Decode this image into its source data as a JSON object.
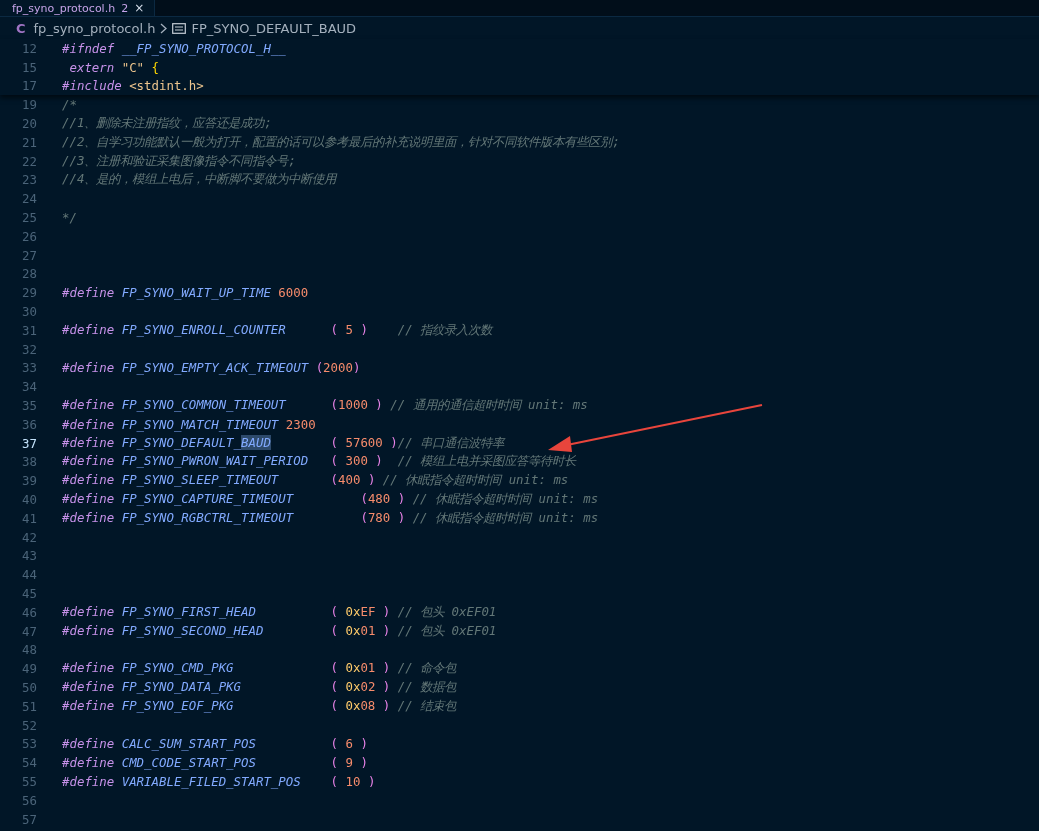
{
  "tab": {
    "label": "fp_syno_protocol.h",
    "badge": "2",
    "close": "×"
  },
  "breadcrumb": {
    "file_icon": "C",
    "file": "fp_syno_protocol.h",
    "symbol": "FP_SYNO_DEFAULT_BAUD"
  },
  "sticky_lines": [
    {
      "number": "12",
      "current": false,
      "tokens": [
        {
          "kind": "directive",
          "text": "#ifndef"
        },
        {
          "kind": "macro",
          "text": " __FP_SYNO_PROTOCOL_H__"
        }
      ]
    },
    {
      "number": "15",
      "current": false,
      "tokens": [
        {
          "kind": "keyword",
          "text": " extern"
        },
        {
          "kind": "string",
          "text": " \"C\""
        },
        {
          "kind": "brace",
          "text": " {"
        }
      ]
    },
    {
      "number": "17",
      "current": false,
      "tokens": [
        {
          "kind": "directive",
          "text": "#include"
        },
        {
          "kind": "header",
          "text": " <stdint.h>"
        }
      ]
    }
  ],
  "lines": [
    {
      "number": "19",
      "current": false,
      "tokens": [
        {
          "kind": "comment",
          "text": "/*"
        }
      ]
    },
    {
      "number": "20",
      "current": false,
      "tokens": [
        {
          "kind": "comment",
          "text": "//1、删除未注册指纹，应答还是成功;"
        }
      ]
    },
    {
      "number": "21",
      "current": false,
      "tokens": [
        {
          "kind": "comment",
          "text": "//2、自学习功能默认一般为打开，配置的话可以参考最后的补充说明里面，针对不同软件版本有些区别;"
        }
      ]
    },
    {
      "number": "22",
      "current": false,
      "tokens": [
        {
          "kind": "comment",
          "text": "//3、注册和验证采集图像指令不同指令号;"
        }
      ]
    },
    {
      "number": "23",
      "current": false,
      "tokens": [
        {
          "kind": "comment",
          "text": "//4、是的，模组上电后，中断脚不要做为中断使用"
        }
      ]
    },
    {
      "number": "24",
      "current": false
    },
    {
      "number": "25",
      "current": false,
      "tokens": [
        {
          "kind": "comment",
          "text": "*/"
        }
      ]
    },
    {
      "number": "26",
      "current": false
    },
    {
      "number": "27",
      "current": false
    },
    {
      "number": "28",
      "current": false
    },
    {
      "number": "29",
      "current": false,
      "tokens": [
        {
          "kind": "directive",
          "text": "#define"
        },
        {
          "kind": "macro",
          "text": " FP_SYNO_WAIT_UP_TIME"
        },
        {
          "kind": "number",
          "text": " 6000"
        }
      ]
    },
    {
      "number": "30",
      "current": false
    },
    {
      "number": "31",
      "current": false,
      "tokens": [
        {
          "kind": "directive",
          "text": "#define"
        },
        {
          "kind": "macro",
          "text": " FP_SYNO_ENROLL_COUNTER"
        },
        {
          "kind": "paren",
          "text": "      ("
        },
        {
          "kind": "number",
          "text": " 5"
        },
        {
          "kind": "paren",
          "text": " )"
        },
        {
          "kind": "comment",
          "text": "    // 指纹录入次数"
        }
      ]
    },
    {
      "number": "32",
      "current": false
    },
    {
      "number": "33",
      "current": false,
      "tokens": [
        {
          "kind": "directive",
          "text": "#define"
        },
        {
          "kind": "macro",
          "text": " FP_SYNO_EMPTY_ACK_TIMEOUT"
        },
        {
          "kind": "paren",
          "text": " ("
        },
        {
          "kind": "number",
          "text": "2000"
        },
        {
          "kind": "paren",
          "text": ")"
        }
      ]
    },
    {
      "number": "34",
      "current": false
    },
    {
      "number": "35",
      "current": false,
      "tokens": [
        {
          "kind": "directive",
          "text": "#define"
        },
        {
          "kind": "macro",
          "text": " FP_SYNO_COMMON_TIMEOUT"
        },
        {
          "kind": "paren",
          "text": "      ("
        },
        {
          "kind": "number",
          "text": "1000"
        },
        {
          "kind": "paren",
          "text": " )"
        },
        {
          "kind": "comment",
          "text": " // 通用的通信超时时间 unit: ms"
        }
      ]
    },
    {
      "number": "36",
      "current": false,
      "tokens": [
        {
          "kind": "directive",
          "text": "#define"
        },
        {
          "kind": "macro",
          "text": " FP_SYNO_MATCH_TIMEOUT"
        },
        {
          "kind": "number",
          "text": " 2300"
        }
      ]
    },
    {
      "number": "37",
      "current": true,
      "tokens": [
        {
          "kind": "directive",
          "text": "#define"
        },
        {
          "kind": "macro",
          "text": " FP_SYNO_DEFAULT_"
        },
        {
          "kind": "macro",
          "text": "BAUD",
          "highlighted": true
        },
        {
          "kind": "paren",
          "text": "        ("
        },
        {
          "kind": "number",
          "text": " 57600"
        },
        {
          "kind": "paren",
          "text": " )"
        },
        {
          "kind": "comment",
          "text": "// 串口通信波特率"
        }
      ]
    },
    {
      "number": "38",
      "current": false,
      "tokens": [
        {
          "kind": "directive",
          "text": "#define"
        },
        {
          "kind": "macro",
          "text": " FP_SYNO_PWRON_WAIT_PERIOD"
        },
        {
          "kind": "paren",
          "text": "   ("
        },
        {
          "kind": "number",
          "text": " 300"
        },
        {
          "kind": "paren",
          "text": " )"
        },
        {
          "kind": "comment",
          "text": "  // 模组上电并采图应答等待时长"
        }
      ]
    },
    {
      "number": "39",
      "current": false,
      "tokens": [
        {
          "kind": "directive",
          "text": "#define"
        },
        {
          "kind": "macro",
          "text": " FP_SYNO_SLEEP_TIMEOUT"
        },
        {
          "kind": "paren",
          "text": "       ("
        },
        {
          "kind": "number",
          "text": "400"
        },
        {
          "kind": "paren",
          "text": " )"
        },
        {
          "kind": "comment",
          "text": " // 休眠指令超时时间 unit: ms"
        }
      ]
    },
    {
      "number": "40",
      "current": false,
      "tokens": [
        {
          "kind": "directive",
          "text": "#define"
        },
        {
          "kind": "macro",
          "text": " FP_SYNO_CAPTURE_TIMEOUT"
        },
        {
          "kind": "paren",
          "text": "         ("
        },
        {
          "kind": "number",
          "text": "480"
        },
        {
          "kind": "paren",
          "text": " )"
        },
        {
          "kind": "comment",
          "text": " // 休眠指令超时时间 unit: ms"
        }
      ]
    },
    {
      "number": "41",
      "current": false,
      "tokens": [
        {
          "kind": "directive",
          "text": "#define"
        },
        {
          "kind": "macro",
          "text": " FP_SYNO_RGBCTRL_TIMEOUT"
        },
        {
          "kind": "paren",
          "text": "         ("
        },
        {
          "kind": "number",
          "text": "780"
        },
        {
          "kind": "paren",
          "text": " )"
        },
        {
          "kind": "comment",
          "text": " // 休眠指令超时时间 unit: ms"
        }
      ]
    },
    {
      "number": "42",
      "current": false
    },
    {
      "number": "43",
      "current": false
    },
    {
      "number": "44",
      "current": false
    },
    {
      "number": "45",
      "current": false
    },
    {
      "number": "46",
      "current": false,
      "tokens": [
        {
          "kind": "directive",
          "text": "#define"
        },
        {
          "kind": "macro",
          "text": " FP_SYNO_FIRST_HEAD"
        },
        {
          "kind": "paren",
          "text": "          ("
        },
        {
          "kind": "hexprefix",
          "text": " 0x"
        },
        {
          "kind": "number",
          "text": "EF"
        },
        {
          "kind": "paren",
          "text": " )"
        },
        {
          "kind": "comment",
          "text": " // 包头 0xEF01"
        }
      ]
    },
    {
      "number": "47",
      "current": false,
      "tokens": [
        {
          "kind": "directive",
          "text": "#define"
        },
        {
          "kind": "macro",
          "text": " FP_SYNO_SECOND_HEAD"
        },
        {
          "kind": "paren",
          "text": "         ("
        },
        {
          "kind": "hexprefix",
          "text": " 0x"
        },
        {
          "kind": "number",
          "text": "01"
        },
        {
          "kind": "paren",
          "text": " )"
        },
        {
          "kind": "comment",
          "text": " // 包头 0xEF01"
        }
      ]
    },
    {
      "number": "48",
      "current": false
    },
    {
      "number": "49",
      "current": false,
      "tokens": [
        {
          "kind": "directive",
          "text": "#define"
        },
        {
          "kind": "macro",
          "text": " FP_SYNO_CMD_PKG"
        },
        {
          "kind": "paren",
          "text": "             ("
        },
        {
          "kind": "hexprefix",
          "text": " 0x"
        },
        {
          "kind": "number",
          "text": "01"
        },
        {
          "kind": "paren",
          "text": " )"
        },
        {
          "kind": "comment",
          "text": " // 命令包"
        }
      ]
    },
    {
      "number": "50",
      "current": false,
      "tokens": [
        {
          "kind": "directive",
          "text": "#define"
        },
        {
          "kind": "macro",
          "text": " FP_SYNO_DATA_PKG"
        },
        {
          "kind": "paren",
          "text": "            ("
        },
        {
          "kind": "hexprefix",
          "text": " 0x"
        },
        {
          "kind": "number",
          "text": "02"
        },
        {
          "kind": "paren",
          "text": " )"
        },
        {
          "kind": "comment",
          "text": " // 数据包"
        }
      ]
    },
    {
      "number": "51",
      "current": false,
      "tokens": [
        {
          "kind": "directive",
          "text": "#define"
        },
        {
          "kind": "macro",
          "text": " FP_SYNO_EOF_PKG"
        },
        {
          "kind": "paren",
          "text": "             ("
        },
        {
          "kind": "hexprefix",
          "text": " 0x"
        },
        {
          "kind": "number",
          "text": "08"
        },
        {
          "kind": "paren",
          "text": " )"
        },
        {
          "kind": "comment",
          "text": " // 结束包"
        }
      ]
    },
    {
      "number": "52",
      "current": false
    },
    {
      "number": "53",
      "current": false,
      "tokens": [
        {
          "kind": "directive",
          "text": "#define"
        },
        {
          "kind": "macro",
          "text": " CALC_SUM_START_POS"
        },
        {
          "kind": "paren",
          "text": "          ("
        },
        {
          "kind": "number",
          "text": " 6"
        },
        {
          "kind": "paren",
          "text": " )"
        }
      ]
    },
    {
      "number": "54",
      "current": false,
      "tokens": [
        {
          "kind": "directive",
          "text": "#define"
        },
        {
          "kind": "macro",
          "text": " CMD_CODE_START_POS"
        },
        {
          "kind": "paren",
          "text": "          ("
        },
        {
          "kind": "number",
          "text": " 9"
        },
        {
          "kind": "paren",
          "text": " )"
        }
      ]
    },
    {
      "number": "55",
      "current": false,
      "tokens": [
        {
          "kind": "directive",
          "text": "#define"
        },
        {
          "kind": "macro",
          "text": " VARIABLE_FILED_START_POS"
        },
        {
          "kind": "paren",
          "text": "    ("
        },
        {
          "kind": "number",
          "text": " 10"
        },
        {
          "kind": "paren",
          "text": " )"
        }
      ]
    },
    {
      "number": "56",
      "current": false
    },
    {
      "number": "57",
      "current": false
    }
  ]
}
